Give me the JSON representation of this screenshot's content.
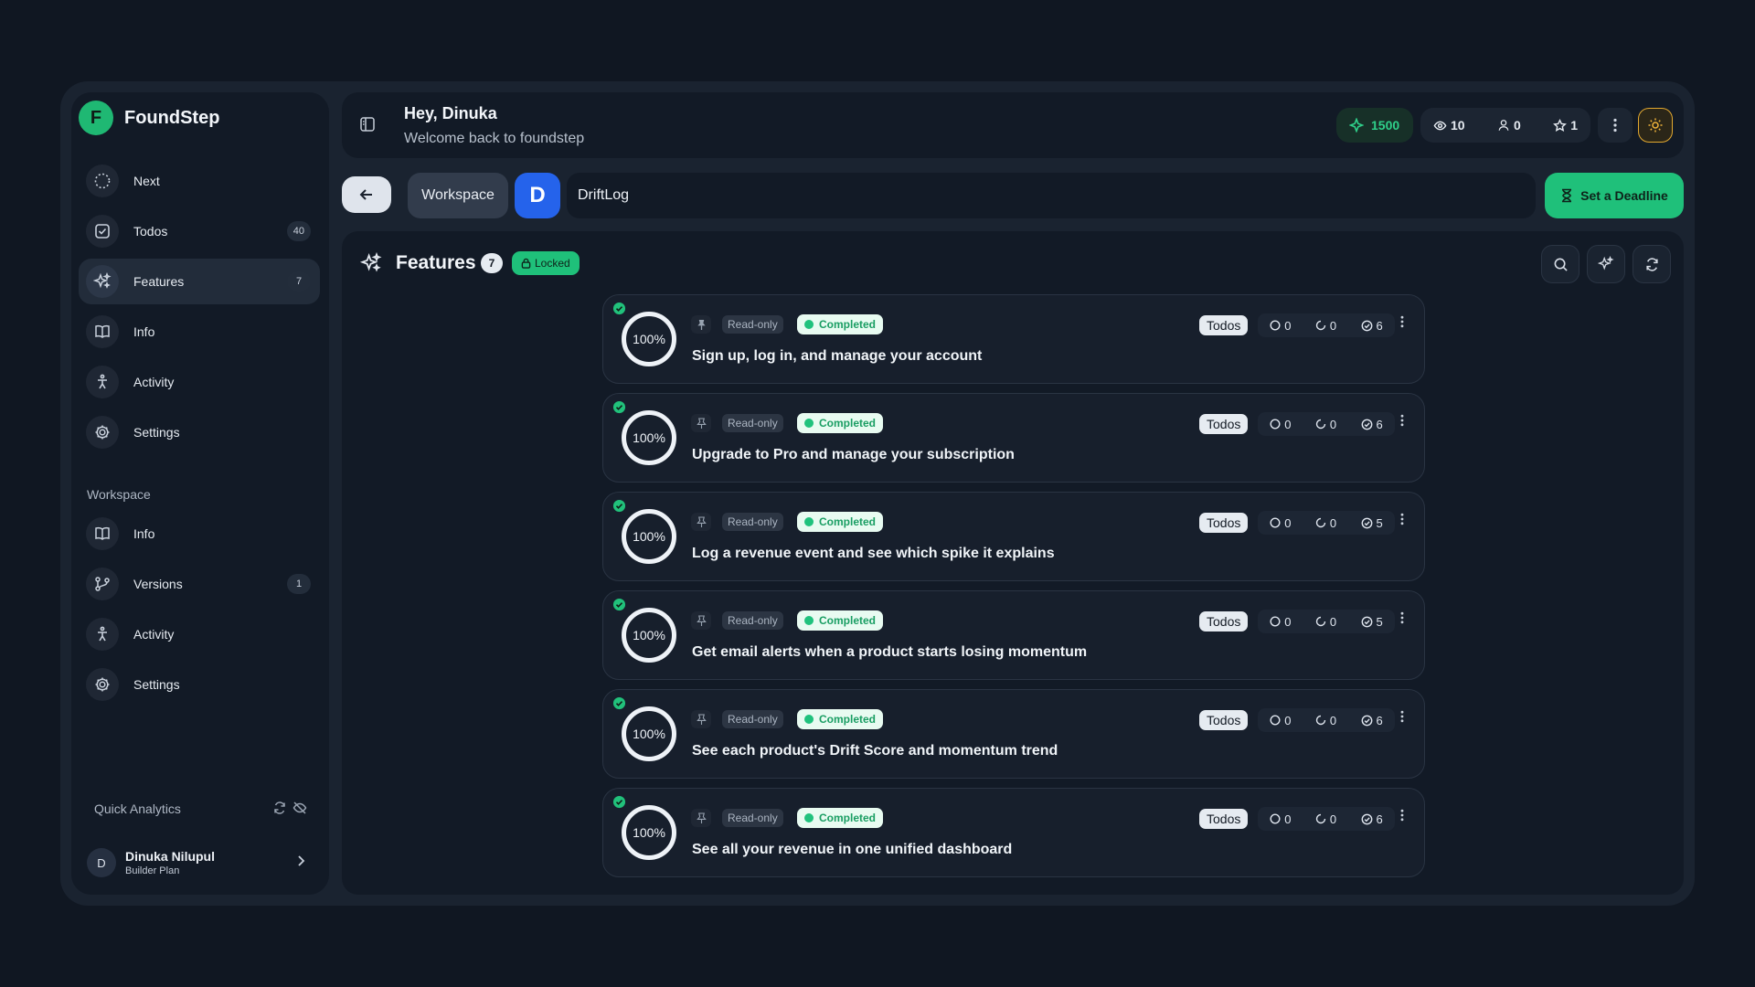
{
  "app": {
    "name": "FoundStep",
    "logo_letter": "F"
  },
  "colors": {
    "accent": "#1fc07a",
    "project": "#2563eb",
    "theme_ring": "#e2a82f"
  },
  "sidebar": {
    "items": [
      {
        "label": "Next",
        "icon": "next-icon"
      },
      {
        "label": "Todos",
        "icon": "checkbox-icon",
        "count": "40"
      },
      {
        "label": "Features",
        "icon": "sparkles-icon",
        "count": "7"
      },
      {
        "label": "Info",
        "icon": "book-icon"
      },
      {
        "label": "Activity",
        "icon": "activity-icon"
      },
      {
        "label": "Settings",
        "icon": "gear-icon"
      }
    ],
    "workspace_title": "Workspace",
    "workspace_items": [
      {
        "label": "Info",
        "icon": "book-icon"
      },
      {
        "label": "Versions",
        "icon": "branch-icon",
        "count": "1"
      },
      {
        "label": "Activity",
        "icon": "activity-icon"
      },
      {
        "label": "Settings",
        "icon": "gear-icon"
      }
    ],
    "quick_analytics": "Quick Analytics",
    "user": {
      "initial": "D",
      "name": "Dinuka Nilupul",
      "plan": "Builder Plan"
    }
  },
  "header": {
    "greeting": "Hey, Dinuka",
    "subtitle": "Welcome back to foundstep",
    "credits": "1500",
    "views": "10",
    "users": "0",
    "stars": "1"
  },
  "breadcrumb": {
    "workspace": "Workspace",
    "project_initial": "D",
    "project_name": "DriftLog",
    "deadline_label": "Set a Deadline"
  },
  "features": {
    "title": "Features",
    "count": "7",
    "locked_label": "Locked",
    "items": [
      {
        "progress": "100%",
        "readonly": "Read-only",
        "status": "Completed",
        "title": "Sign up, log in, and manage your account",
        "todos_label": "Todos",
        "open": "0",
        "in_progress": "0",
        "done": "6"
      },
      {
        "progress": "100%",
        "readonly": "Read-only",
        "status": "Completed",
        "title": "Upgrade to Pro and manage your subscription",
        "todos_label": "Todos",
        "open": "0",
        "in_progress": "0",
        "done": "6"
      },
      {
        "progress": "100%",
        "readonly": "Read-only",
        "status": "Completed",
        "title": "Log a revenue event and see which spike it explains",
        "todos_label": "Todos",
        "open": "0",
        "in_progress": "0",
        "done": "5"
      },
      {
        "progress": "100%",
        "readonly": "Read-only",
        "status": "Completed",
        "title": "Get email alerts when a product starts losing momentum",
        "todos_label": "Todos",
        "open": "0",
        "in_progress": "0",
        "done": "5"
      },
      {
        "progress": "100%",
        "readonly": "Read-only",
        "status": "Completed",
        "title": "See each product's Drift Score and momentum trend",
        "todos_label": "Todos",
        "open": "0",
        "in_progress": "0",
        "done": "6"
      },
      {
        "progress": "100%",
        "readonly": "Read-only",
        "status": "Completed",
        "title": "See all your revenue in one unified dashboard",
        "todos_label": "Todos",
        "open": "0",
        "in_progress": "0",
        "done": "6"
      }
    ]
  }
}
